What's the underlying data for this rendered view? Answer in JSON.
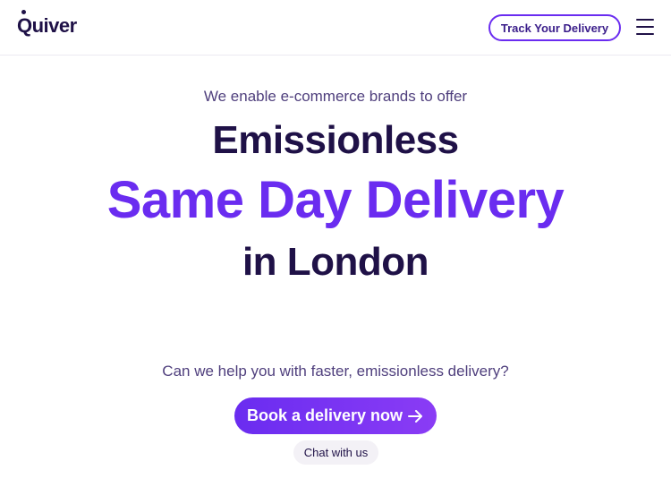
{
  "header": {
    "logo_text": "Quiver",
    "track_button_label": "Track Your Delivery"
  },
  "hero": {
    "eyebrow": "We enable e-commerce brands to offer",
    "line1": "Emissionless",
    "line2": "Same Day Delivery",
    "line3": "in London"
  },
  "cta": {
    "question": "Can we help you with faster, emissionless delivery?",
    "book_label": "Book a delivery now",
    "chat_label": "Chat with us"
  },
  "icons": {
    "menu": "hamburger-menu-icon",
    "arrow": "arrow-right-icon"
  },
  "colors": {
    "brand_purple": "#6a2cf0",
    "dark_navy": "#1f1147",
    "muted_text": "#4f3f7d"
  }
}
